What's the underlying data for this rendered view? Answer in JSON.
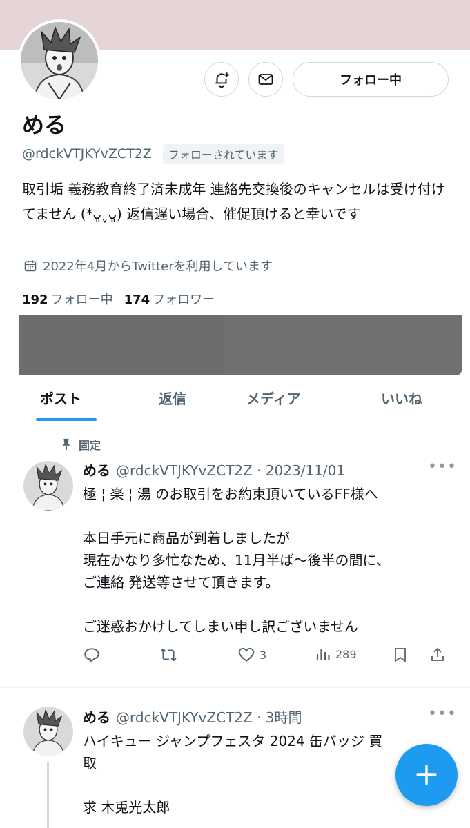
{
  "profile": {
    "display_name": "める",
    "handle": "@rdckVTJKYvZCT2Z",
    "follows_you": "フォローされています",
    "follow_button": "フォロー中",
    "bio": "取引垢 義務教育終了済未成年 連絡先交換後のキャンセルは受け付けてません (*ᴗ͈ˬᴗ͈) 返信遅い場合、催促頂けると幸いです",
    "joined": "2022年4月からTwitterを利用しています",
    "following_count": "192",
    "following_label": "フォロー中",
    "followers_count": "174",
    "followers_label": "フォロワー"
  },
  "icons": {
    "notify": "bell-plus-icon",
    "message": "envelope-icon",
    "calendar": "calendar-icon",
    "pin": "pin-icon",
    "more": "more-icon",
    "reply": "reply-icon",
    "retweet": "retweet-icon",
    "like": "heart-icon",
    "views": "views-icon",
    "bookmark": "bookmark-icon",
    "share": "share-icon",
    "compose": "plus-icon"
  },
  "tabs": [
    {
      "label": "ポスト",
      "active": true
    },
    {
      "label": "返信",
      "active": false
    },
    {
      "label": "メディア",
      "active": false
    },
    {
      "label": "いいね",
      "active": false
    }
  ],
  "tweets": [
    {
      "pinned_label": "固定",
      "name": "める",
      "meta": "@rdckVTJKYvZCT2Z · 2023/11/01",
      "text": "極 ¦ 楽 ¦ 湯 のお取引をお約束頂いているFF様へ\n\n本日手元に商品が到着しましたが\n現在かなり多忙なため、11月半ば〜後半の間に、\nご連絡 発送等させて頂きます。\n\nご迷惑おかけしてしまい申し訳ございません",
      "likes": "3",
      "views": "289"
    },
    {
      "name": "める",
      "meta": "@rdckVTJKYvZCT2Z · 3時間",
      "text": "ハイキュー ジャンプフェスタ 2024 缶バッジ 買\n取\n\n求 木兎光太郎"
    }
  ],
  "colors": {
    "accent": "#1d9bf0",
    "text": "#0f1419",
    "muted": "#536471",
    "banner": "#e6d5d7"
  }
}
